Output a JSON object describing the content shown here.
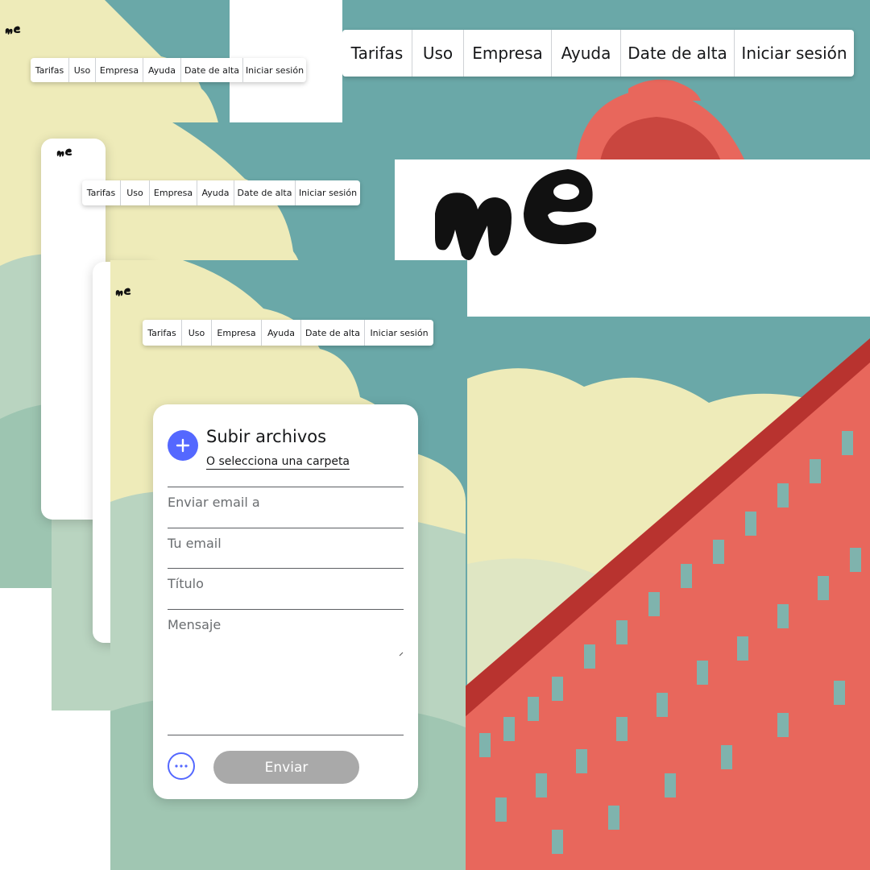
{
  "nav": {
    "items": [
      {
        "id": "tarifas",
        "label": "Tarifas"
      },
      {
        "id": "uso",
        "label": "Uso"
      },
      {
        "id": "empresa",
        "label": "Empresa"
      },
      {
        "id": "ayuda",
        "label": "Ayuda"
      },
      {
        "id": "date-de-alta",
        "label": "Date de alta"
      },
      {
        "id": "iniciar-sesion",
        "label": "Iniciar sesión"
      }
    ]
  },
  "upload_card": {
    "upload_title": "Subir archivos",
    "folder_link": "O selecciona una carpeta",
    "email_to_placeholder": "Enviar email a",
    "your_email_placeholder": "Tu email",
    "title_placeholder": "Título",
    "message_placeholder": "Mensaje",
    "send_label": "Enviar"
  },
  "colors": {
    "sky": "#6aa8a8",
    "clouds": "#eeebb9",
    "building": "#e8675c",
    "accent": "#5468ff",
    "send_disabled": "#a9a9a9"
  },
  "icons": [
    "we-logo",
    "plus-icon",
    "more-options-icon"
  ]
}
